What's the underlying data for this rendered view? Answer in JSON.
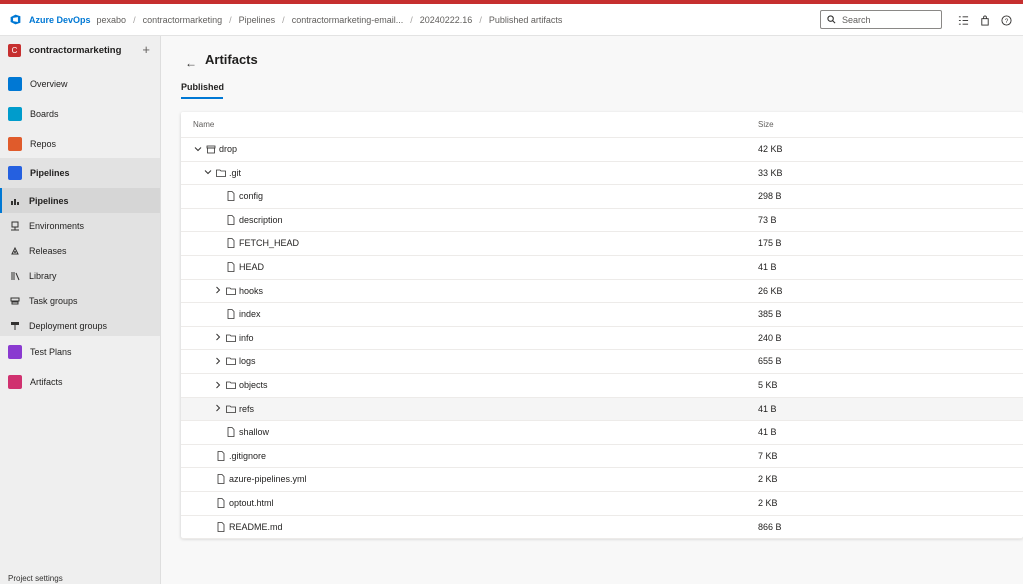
{
  "app": {
    "brand": "Azure DevOps"
  },
  "breadcrumbs": [
    "pexabo",
    "contractormarketing",
    "Pipelines",
    "contractormarketing-email...",
    "20240222.16",
    "Published artifacts"
  ],
  "search": {
    "placeholder": "Search"
  },
  "colors": {
    "accent": "#0078d4",
    "topbar_red": "#c62f2f"
  },
  "sidebar": {
    "project_initial": "C",
    "project_name": "contractormarketing",
    "add_label": "+",
    "items": [
      {
        "label": "Overview",
        "icon": "overview-icon",
        "color": "#0078d4"
      },
      {
        "label": "Boards",
        "icon": "boards-icon",
        "color": "#009ccc"
      },
      {
        "label": "Repos",
        "icon": "repos-icon",
        "color": "#e05b2b"
      },
      {
        "label": "Pipelines",
        "icon": "pipelines-icon",
        "color": "#2560e0"
      }
    ],
    "pipeline_subs": [
      {
        "label": "Pipelines",
        "icon": "pipelines-sub-icon"
      },
      {
        "label": "Environments",
        "icon": "environments-icon"
      },
      {
        "label": "Releases",
        "icon": "releases-icon"
      },
      {
        "label": "Library",
        "icon": "library-icon"
      },
      {
        "label": "Task groups",
        "icon": "task-groups-icon"
      },
      {
        "label": "Deployment groups",
        "icon": "deployment-groups-icon"
      }
    ],
    "after_items": [
      {
        "label": "Test Plans",
        "icon": "test-plans-icon",
        "color": "#8a3ad0"
      },
      {
        "label": "Artifacts",
        "icon": "artifacts-icon",
        "color": "#d0316f"
      }
    ],
    "bottom_text": "Project settings"
  },
  "main": {
    "title": "Artifacts",
    "tab": "Published",
    "columns": {
      "name": "Name",
      "size": "Size"
    },
    "rows": [
      {
        "name": "drop",
        "size": "42 KB",
        "level": 0,
        "type": "artifact",
        "expanded": true
      },
      {
        "name": ".git",
        "size": "33 KB",
        "level": 1,
        "type": "folder",
        "expanded": true
      },
      {
        "name": "config",
        "size": "298 B",
        "level": 2,
        "type": "file"
      },
      {
        "name": "description",
        "size": "73 B",
        "level": 2,
        "type": "file"
      },
      {
        "name": "FETCH_HEAD",
        "size": "175 B",
        "level": 2,
        "type": "file"
      },
      {
        "name": "HEAD",
        "size": "41 B",
        "level": 2,
        "type": "file"
      },
      {
        "name": "hooks",
        "size": "26 KB",
        "level": 2,
        "type": "folder",
        "expanded": false
      },
      {
        "name": "index",
        "size": "385 B",
        "level": 2,
        "type": "file"
      },
      {
        "name": "info",
        "size": "240 B",
        "level": 2,
        "type": "folder",
        "expanded": false
      },
      {
        "name": "logs",
        "size": "655 B",
        "level": 2,
        "type": "folder",
        "expanded": false
      },
      {
        "name": "objects",
        "size": "5 KB",
        "level": 2,
        "type": "folder",
        "expanded": false
      },
      {
        "name": "refs",
        "size": "41 B",
        "level": 2,
        "type": "folder",
        "expanded": false,
        "hover": true
      },
      {
        "name": "shallow",
        "size": "41 B",
        "level": 2,
        "type": "file"
      },
      {
        "name": ".gitignore",
        "size": "7 KB",
        "level": 1,
        "type": "file"
      },
      {
        "name": "azure-pipelines.yml",
        "size": "2 KB",
        "level": 1,
        "type": "file"
      },
      {
        "name": "optout.html",
        "size": "2 KB",
        "level": 1,
        "type": "file"
      },
      {
        "name": "README.md",
        "size": "866 B",
        "level": 1,
        "type": "file"
      }
    ]
  }
}
